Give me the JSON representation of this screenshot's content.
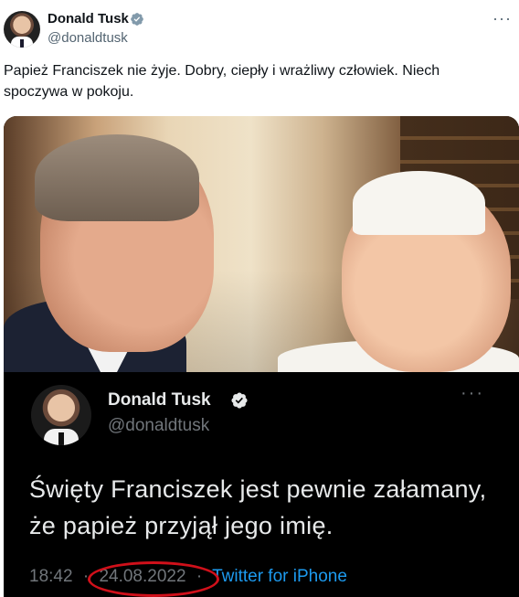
{
  "tweet": {
    "author_name": "Donald Tusk",
    "author_handle": "@donaldtusk",
    "more_icon": "more-horizontal-icon",
    "text": "Papież Franciszek nie żyje. Dobry, ciepły i wrażliwy człowiek. Niech spoczywa w pokoju."
  },
  "embedded_screenshot": {
    "author_name": "Donald Tusk",
    "author_handle": "@donaldtusk",
    "text": "Święty Franciszek jest pewnie załamany, że papież przyjął jego imię.",
    "time": "18:42",
    "separator": "·",
    "date": "24.08.2022",
    "source": "Twitter for iPhone"
  },
  "colors": {
    "verified_blue": "#1d9bf0",
    "highlight_circle": "#d0101a",
    "dark_bg": "#000000"
  }
}
